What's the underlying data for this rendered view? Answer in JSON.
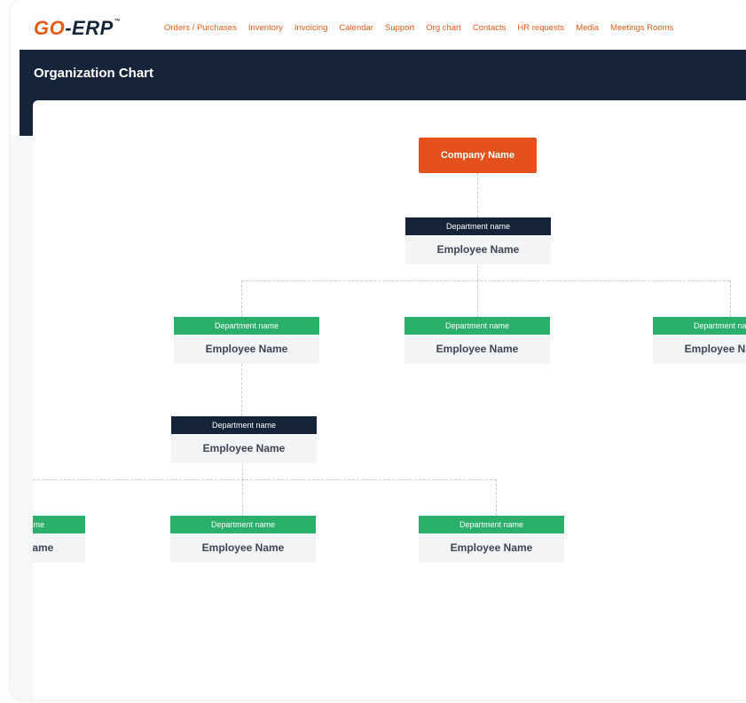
{
  "app": {
    "logo_text": "GO-ERP",
    "logo_prefix": "GO",
    "logo_suffix": "-ERP",
    "logo_tm": "™"
  },
  "nav": {
    "items": [
      "Orders / Purchases",
      "Inventory",
      "Invoicing",
      "Calendar",
      "Support",
      "Org chart",
      "Contacts",
      "HR requests",
      "Media",
      "Meetings Rooms"
    ]
  },
  "page": {
    "title": "Organization Chart"
  },
  "org": {
    "company": "Company Name",
    "level1": {
      "dept": "Department name",
      "employee": "Employee Name"
    },
    "level2": [
      {
        "dept": "Department name",
        "employee": "Employee Name"
      },
      {
        "dept": "Department name",
        "employee": "Employee Name"
      },
      {
        "dept": "Department name",
        "employee": "Employee Name"
      }
    ],
    "level3": {
      "dept": "Department name",
      "employee": "Employee Name"
    },
    "level4": [
      {
        "dept": "Department name",
        "employee": "Employee Name"
      },
      {
        "dept": "Department name",
        "employee": "Employee Name"
      },
      {
        "dept": "Department name",
        "employee": "Employee Name"
      }
    ]
  },
  "colors": {
    "brand_orange": "#ea5a17",
    "navy": "#16243a",
    "green": "#2ab06a",
    "accent_blue": "#4fa8e6"
  }
}
